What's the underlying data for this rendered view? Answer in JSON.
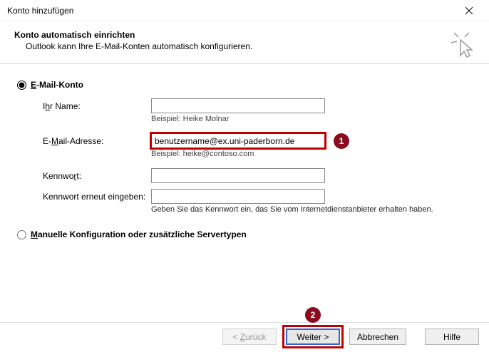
{
  "window": {
    "title": "Konto hinzufügen"
  },
  "header": {
    "title": "Konto automatisch einrichten",
    "subtitle": "Outlook kann Ihre E-Mail-Konten automatisch konfigurieren."
  },
  "radio": {
    "email_account": "-Mail-Konto",
    "email_account_hotkey": "E",
    "manual": "anuelle Konfiguration oder zusätzliche Servertypen",
    "manual_hotkey": "M"
  },
  "form": {
    "name_label_pre": "I",
    "name_label_hot": "h",
    "name_label_post": "r Name:",
    "name_value": "",
    "name_example": "Beispiel: Heike Molnar",
    "email_label_pre": "E-",
    "email_label_hot": "M",
    "email_label_post": "ail-Adresse:",
    "email_value": "benutzername@ex.uni-paderborn.de",
    "email_example": "Beispiel: heike@contoso.com",
    "pw_label_pre": "Kennwo",
    "pw_label_hot": "r",
    "pw_label_post": "t:",
    "pw_value": "",
    "pw2_label_pre": "Kennwort erneut ein",
    "pw2_label_hot": "g",
    "pw2_label_post": "eben:",
    "pw2_value": "",
    "pw_hint": "Geben Sie das Kennwort ein, das Sie vom Internetdienstanbieter erhalten haben."
  },
  "buttons": {
    "back_pre": "< ",
    "back_hot": "Z",
    "back_post": "urück",
    "next_hot": "W",
    "next_post": "eiter >",
    "cancel": "Abbrechen",
    "help": "Hilfe"
  },
  "annotations": {
    "badge1": "1",
    "badge2": "2"
  }
}
